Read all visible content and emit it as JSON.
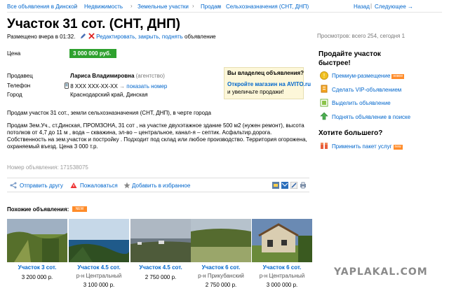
{
  "breadcrumbs": [
    "Все объявления в Динской",
    "Недвижимость",
    "Земельные участки",
    "Продам",
    "Сельхозназначения (СНТ, ДНП)"
  ],
  "nav": {
    "back": "Назад",
    "next": "Следующее →"
  },
  "title": "Участок 31 сот. (СНТ, ДНП)",
  "meta": {
    "placed": "Размещено вчера в 01:32.",
    "edit": "Редактировать, закрыть, поднять",
    "edit_suffix": "объявление"
  },
  "views": "Просмотров: всего 254, сегодня 1",
  "fields": {
    "price_label": "Цена",
    "price": "3 000 000 руб.",
    "seller_label": "Продавец",
    "seller": "Лариса Владимировна",
    "seller_note": "(агентство)",
    "phone_label": "Телефон",
    "phone": "8 XXX XXX-XX-XX",
    "phone_show": "показать номер",
    "city_label": "Город",
    "city": "Краснодарский край, Динская"
  },
  "owner_box": {
    "heading": "Вы владелец объявления?",
    "link": "Откройте магазин на AVITO.ru",
    "text": "и увеличьте продажи!"
  },
  "description": {
    "short": "Продам участок 31 сот., земли сельхозназначения (СНТ, ДНП), в черте города",
    "full": "Продам Зем.Уч., ст.Динская, ПРОМЗОНА, 31 сот , на участке двухэтажное здание 500 м2 (нужен ремонт), высота потолков от 4,7 до 11 м , вода – скважина, эл-во – центральное, канал-я – септик. Асфальтир.дорога. Собственность на зем.участок и постройку . Подходит под склад или любое производство. Территория огорожена, охраняемый въезд. Цена 3 000 т.р."
  },
  "ad_number": "Номер объявления: 171538075",
  "actions": {
    "send": "Отправить другу",
    "complain": "Пожаловаться",
    "favorite": "Добавить в избранное"
  },
  "similar": {
    "heading": "Похожие объявления:",
    "badge": "NEW",
    "items": [
      {
        "title": "Участок 3 сот.",
        "price": "3 200 000 р.",
        "district": ""
      },
      {
        "title": "Участок 4.5 сот.",
        "price": "3 100 000 р.",
        "district": "р-н Центральный"
      },
      {
        "title": "Участок 4.5 сот.",
        "price": "2 750 000 р.",
        "district": ""
      },
      {
        "title": "Участок 6 сот.",
        "price": "2 750 000 р.",
        "district": "р-н Прикубанский"
      },
      {
        "title": "Участок 6 сот.",
        "price": "3 000 000 р.",
        "district": "р-н Центральный"
      }
    ]
  },
  "sidebar": {
    "sell_faster": "Продайте участок быстрее!",
    "premium": "Премиум-размещение",
    "premium_tag": "новое",
    "vip": "Сделать VIP-объявлением",
    "highlight": "Выделить объявление",
    "raise": "Поднять объявление в поиске",
    "want_more": "Хотите большего?",
    "package": "Применить пакет услуг",
    "package_tag": "new"
  },
  "watermark": "YAPLAKAL.COM",
  "colors": {
    "link": "#0066cc",
    "price_bg": "#2ea12e",
    "badge": "#ff8c2a",
    "owner_bg": "#fdf7d9"
  }
}
